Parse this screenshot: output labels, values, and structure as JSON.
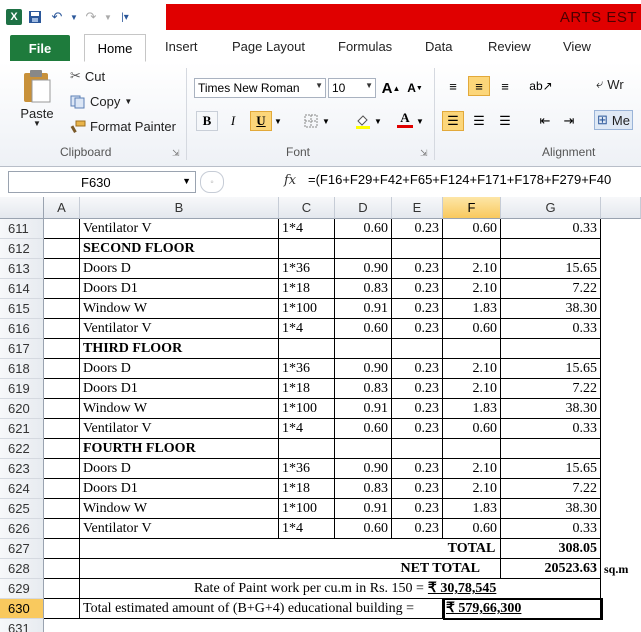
{
  "app": {
    "title": "ARTS EST"
  },
  "ribbon_tabs": [
    "File",
    "Home",
    "Insert",
    "Page Layout",
    "Formulas",
    "Data",
    "Review",
    "View"
  ],
  "clipboard": {
    "paste": "Paste",
    "cut": "Cut",
    "copy": "Copy",
    "format_painter": "Format Painter",
    "group": "Clipboard"
  },
  "font": {
    "name": "Times New Roman",
    "size": "10",
    "bold": "B",
    "italic": "I",
    "underline": "U",
    "grow": "A",
    "shrink": "A",
    "color_letter": "A",
    "group": "Font"
  },
  "alignment": {
    "group": "Alignment",
    "wrap": "Wr",
    "merge": "Me"
  },
  "formula_bar": {
    "name_box": "F630",
    "fx": "fx",
    "formula": "=(F16+F29+F42+F65+F124+F171+F178+F279+F40"
  },
  "columns": [
    "A",
    "B",
    "C",
    "D",
    "E",
    "F",
    "G"
  ],
  "rows": [
    {
      "num": "611",
      "b": "Ventilator V",
      "c": "1*4",
      "d": "0.60",
      "e": "0.23",
      "f": "0.60",
      "g": "0.33"
    },
    {
      "num": "612",
      "b": "SECOND FLOOR",
      "heading": true
    },
    {
      "num": "613",
      "b": "Doors D",
      "c": "1*36",
      "d": "0.90",
      "e": "0.23",
      "f": "2.10",
      "g": "15.65"
    },
    {
      "num": "614",
      "b": "Doors D1",
      "c": "1*18",
      "d": "0.83",
      "e": "0.23",
      "f": "2.10",
      "g": "7.22"
    },
    {
      "num": "615",
      "b": "Window W",
      "c": "1*100",
      "d": "0.91",
      "e": "0.23",
      "f": "1.83",
      "g": "38.30"
    },
    {
      "num": "616",
      "b": "Ventilator V",
      "c": "1*4",
      "d": "0.60",
      "e": "0.23",
      "f": "0.60",
      "g": "0.33"
    },
    {
      "num": "617",
      "b": "THIRD FLOOR",
      "heading": true
    },
    {
      "num": "618",
      "b": "Doors D",
      "c": "1*36",
      "d": "0.90",
      "e": "0.23",
      "f": "2.10",
      "g": "15.65"
    },
    {
      "num": "619",
      "b": "Doors D1",
      "c": "1*18",
      "d": "0.83",
      "e": "0.23",
      "f": "2.10",
      "g": "7.22"
    },
    {
      "num": "620",
      "b": "Window W",
      "c": "1*100",
      "d": "0.91",
      "e": "0.23",
      "f": "1.83",
      "g": "38.30"
    },
    {
      "num": "621",
      "b": "Ventilator V",
      "c": "1*4",
      "d": "0.60",
      "e": "0.23",
      "f": "0.60",
      "g": "0.33"
    },
    {
      "num": "622",
      "b": "FOURTH FLOOR",
      "heading": true
    },
    {
      "num": "623",
      "b": "Doors D",
      "c": "1*36",
      "d": "0.90",
      "e": "0.23",
      "f": "2.10",
      "g": "15.65"
    },
    {
      "num": "624",
      "b": "Doors D1",
      "c": "1*18",
      "d": "0.83",
      "e": "0.23",
      "f": "2.10",
      "g": "7.22"
    },
    {
      "num": "625",
      "b": "Window W",
      "c": "1*100",
      "d": "0.91",
      "e": "0.23",
      "f": "1.83",
      "g": "38.30"
    },
    {
      "num": "626",
      "b": "Ventilator V",
      "c": "1*4",
      "d": "0.60",
      "e": "0.23",
      "f": "0.60",
      "g": "0.33"
    }
  ],
  "summary": {
    "r627": {
      "num": "627",
      "label": "TOTAL",
      "value": "308.05"
    },
    "r628": {
      "num": "628",
      "label": "NET TOTAL",
      "value": "20523.63",
      "unit": "sq.m"
    },
    "r629": {
      "num": "629",
      "text": "Rate of Paint work per cu.m in Rs. 150 =",
      "amount": "₹ 30,78,545"
    },
    "r630": {
      "num": "630",
      "text": "Total estimated amount of (B+G+4) educational building =",
      "amount": "₹ 579,66,300"
    },
    "r631": {
      "num": "631"
    }
  },
  "colors": {
    "excel_green": "#1e7145",
    "title_band": "#e00000",
    "selected_header": "#f9c95e"
  }
}
